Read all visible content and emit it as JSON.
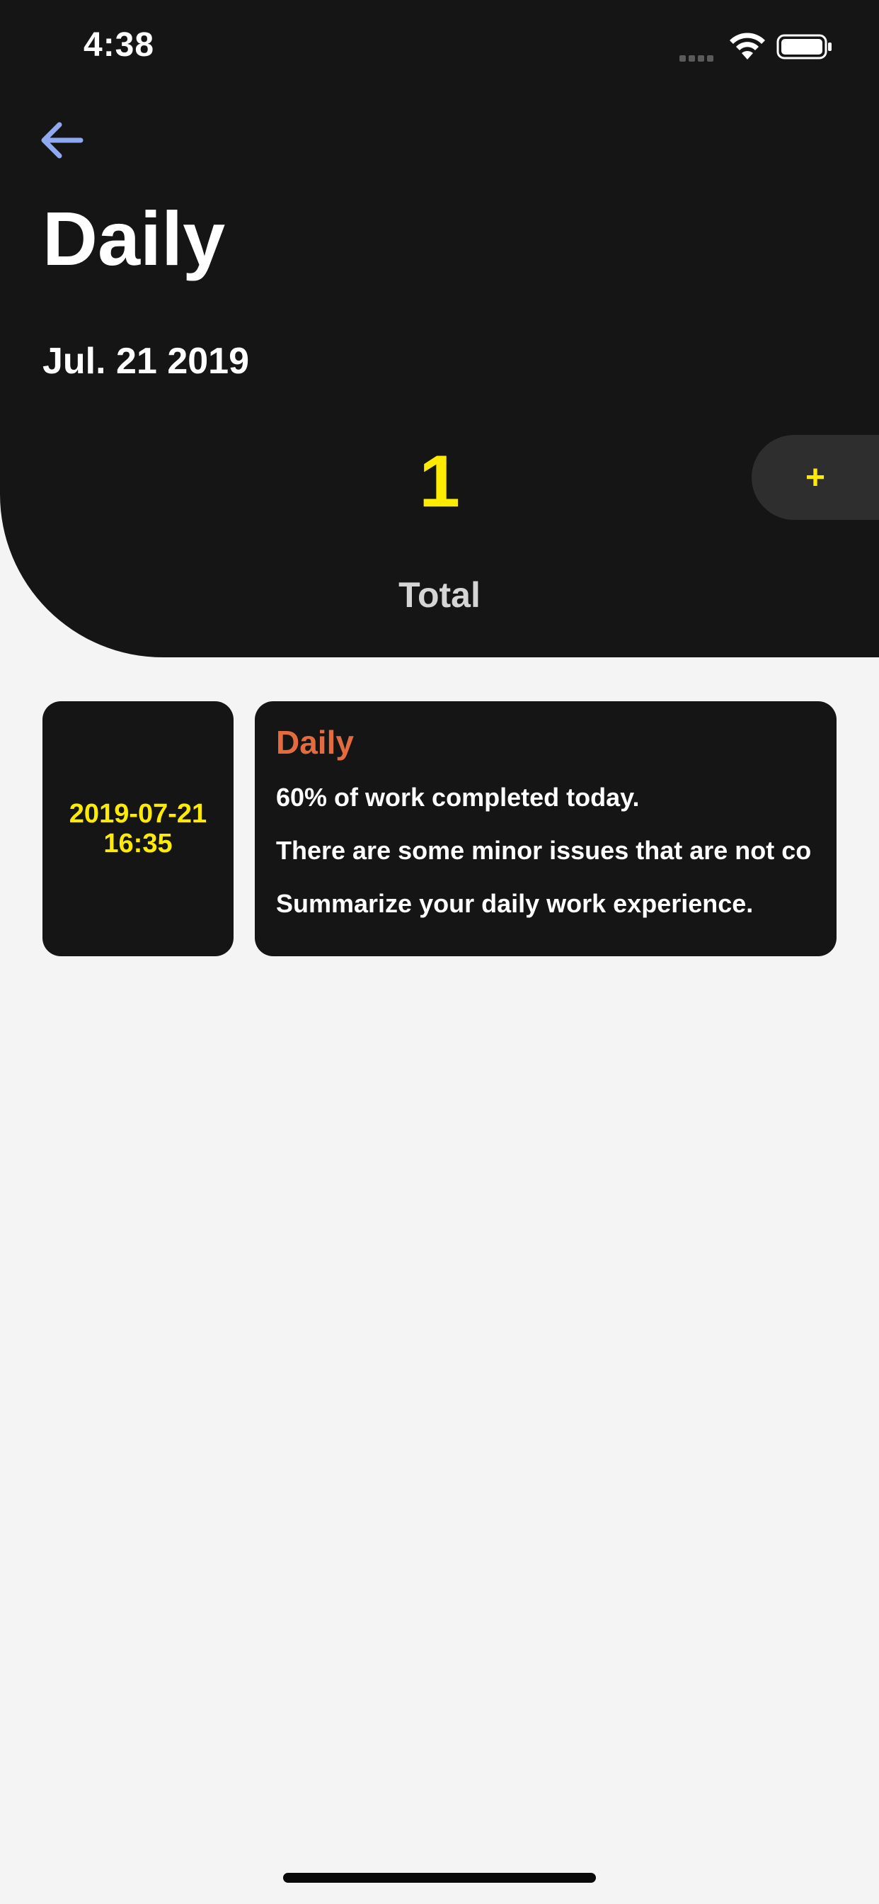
{
  "status_bar": {
    "time": "4:38"
  },
  "header": {
    "title": "Daily",
    "date": "Jul. 21 2019",
    "total_count": "1",
    "total_label": "Total",
    "add_label": "+"
  },
  "entries": [
    {
      "date": "2019-07-21",
      "time": "16:35",
      "title": "Daily",
      "lines": [
        "60% of work completed today.",
        "There are some minor issues that are not co",
        "Summarize your daily work experience."
      ]
    }
  ],
  "colors": {
    "header_background": "#151516",
    "page_background": "#f4f4f4",
    "accent_yellow": "#ffeb00",
    "entry_title": "#e26b40",
    "back_arrow": "#8fa8f0"
  },
  "icons": {
    "back": "arrow-left-icon",
    "wifi": "wifi-icon",
    "battery": "battery-icon",
    "signal": "cellular-signal-icon"
  }
}
